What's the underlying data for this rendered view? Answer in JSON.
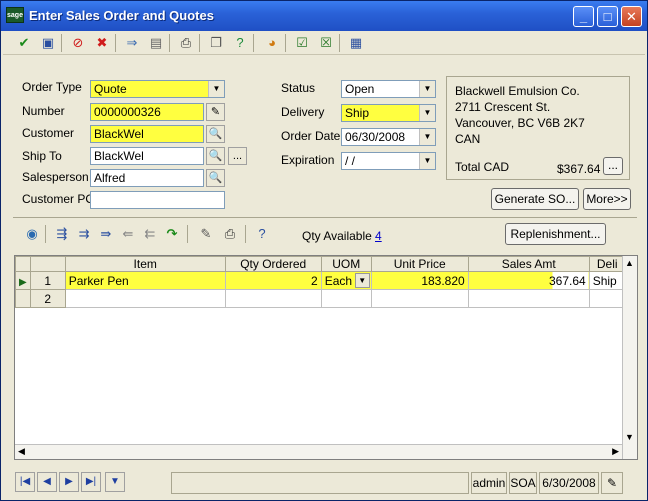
{
  "window": {
    "app_icon_text": "sage",
    "title": "Enter Sales Order and Quotes"
  },
  "toolbar": {
    "icons": [
      "accept-icon",
      "save-icon",
      "cancel-icon",
      "delete-icon",
      "export-icon",
      "notes-icon",
      "print-icon",
      "copy-icon",
      "help-icon",
      "color-wheel-icon",
      "check-icon",
      "check-all-icon",
      "table-icon"
    ]
  },
  "header": {
    "order_type": {
      "label": "Order Type",
      "value": "Quote"
    },
    "number": {
      "label": "Number",
      "value": "0000000326"
    },
    "customer": {
      "label": "Customer",
      "value": "BlackWel"
    },
    "ship_to": {
      "label": "Ship To",
      "value": "BlackWel",
      "ellipsis": "..."
    },
    "salesperson": {
      "label": "Salesperson",
      "value": "Alfred"
    },
    "customer_po": {
      "label": "Customer PO",
      "value": ""
    },
    "status": {
      "label": "Status",
      "value": "Open"
    },
    "delivery": {
      "label": "Delivery",
      "value": "Ship"
    },
    "order_date": {
      "label": "Order Date",
      "value": "06/30/2008"
    },
    "expiration": {
      "label": "Expiration",
      "value": " /  /"
    }
  },
  "address": {
    "line1": "Blackwell Emulsion Co.",
    "line2": "2711 Crescent St.",
    "line3": "Vancouver, BC  V6B 2K7",
    "line4": "CAN",
    "total_label": "Total CAD",
    "total_value": "$367.64",
    "total_btn": "..."
  },
  "buttons": {
    "generate_so": "Generate SO...",
    "more": "More>>",
    "replenishment": "Replenishment..."
  },
  "detail_toolbar": {
    "qty_available_label": "Qty Available",
    "qty_available_value": "4"
  },
  "grid": {
    "columns": [
      "Item",
      "Qty Ordered",
      "UOM",
      "Unit Price",
      "Sales Amt",
      "Deli"
    ],
    "rows": [
      {
        "no": "1",
        "item": "Parker Pen",
        "qty": "2",
        "uom": "Each",
        "price": "183.820",
        "amt": "367.64",
        "deli": "Ship"
      },
      {
        "no": "2",
        "item": "",
        "qty": "",
        "uom": "",
        "price": "",
        "amt": "",
        "deli": ""
      }
    ]
  },
  "status_bar": {
    "user": "admin",
    "module": "SOA",
    "date": "6/30/2008"
  }
}
